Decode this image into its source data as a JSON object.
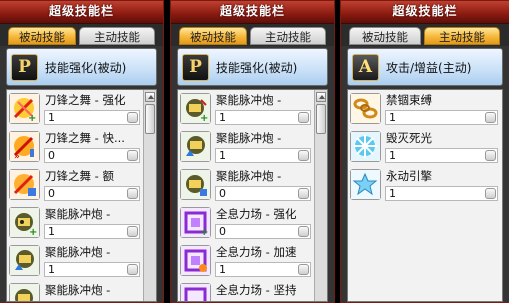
{
  "panels": [
    {
      "title": "超级技能栏",
      "tabs": [
        "被动技能",
        "主动技能"
      ],
      "active_tab": 0,
      "header": {
        "badge": "P",
        "text": "技能强化(被动)"
      },
      "skills": [
        {
          "name": "刀锋之舞 - 强化",
          "level": "1",
          "icon": "blade-dance-icon"
        },
        {
          "name": "刀锋之舞 - 快...",
          "level": "0",
          "icon": "blade-dance-speed-icon"
        },
        {
          "name": "刀锋之舞 - 额",
          "level": "0",
          "icon": "blade-dance-extra-icon"
        },
        {
          "name": "聚能脉冲炮 -",
          "level": "1",
          "icon": "pulse-cannon-icon"
        },
        {
          "name": "聚能脉冲炮 -",
          "level": "1",
          "icon": "pulse-cannon-up-icon"
        },
        {
          "name": "聚能脉冲炮 -",
          "level": "",
          "icon": "pulse-cannon-icon"
        }
      ]
    },
    {
      "title": "超级技能栏",
      "tabs": [
        "被动技能",
        "主动技能"
      ],
      "active_tab": 0,
      "header": {
        "badge": "P",
        "text": "技能强化(被动)"
      },
      "skills": [
        {
          "name": "聚能脉冲炮 -",
          "level": "1",
          "icon": "pulse-cannon-icon"
        },
        {
          "name": "聚能脉冲炮 -",
          "level": "1",
          "icon": "pulse-cannon-up-icon"
        },
        {
          "name": "聚能脉冲炮 -",
          "level": "0",
          "icon": "pulse-cannon-icon"
        },
        {
          "name": "全息力场 - 强化",
          "level": "0",
          "icon": "hologram-field-icon"
        },
        {
          "name": "全息力场 - 加速",
          "level": "1",
          "icon": "hologram-field-speed-icon"
        },
        {
          "name": "全息力场 - 坚持",
          "level": "",
          "icon": "hologram-field-icon"
        }
      ]
    },
    {
      "title": "超级技能栏",
      "tabs": [
        "被动技能",
        "主动技能"
      ],
      "active_tab": 1,
      "header": {
        "badge": "A",
        "text": "攻击/增益(主动)"
      },
      "skills": [
        {
          "name": "禁锢束缚",
          "level": "1",
          "icon": "binding-chain-icon"
        },
        {
          "name": "毁灭死光",
          "level": "1",
          "icon": "doom-ray-icon"
        },
        {
          "name": "永动引擎",
          "level": "1",
          "icon": "perpetual-engine-icon"
        }
      ]
    }
  ],
  "colors": {
    "title_bar": "#a02a1c",
    "active_tab": "#f6b73a",
    "header_bg": "#c9e0f7"
  }
}
